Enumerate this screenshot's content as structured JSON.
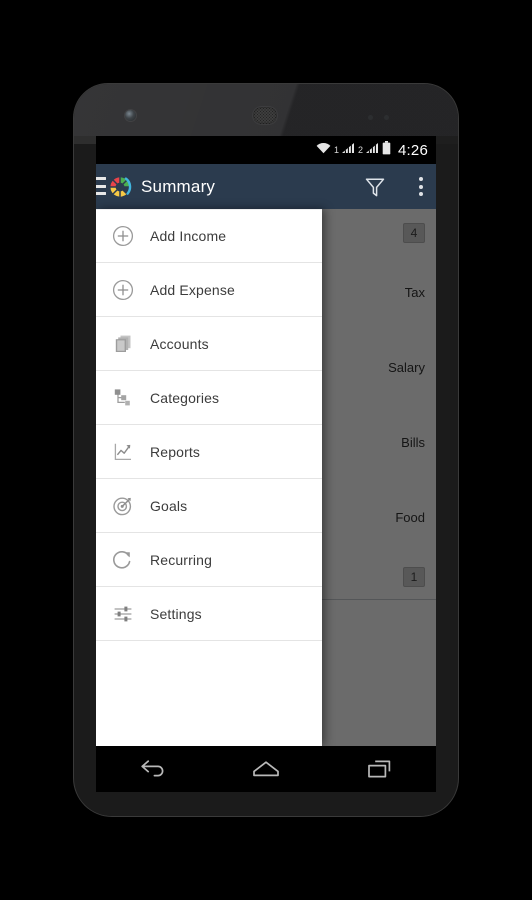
{
  "status_bar": {
    "wifi_icon": "wifi-icon",
    "sim1_label": "1",
    "sim1_signal_icon": "signal-bars-icon",
    "sim2_label": "2",
    "sim2_signal_icon": "signal-bars-icon",
    "battery_icon": "battery-full-icon",
    "clock": "4:26"
  },
  "action_bar": {
    "drawer_toggle_icon": "hamburger-menu-icon",
    "logo_icon": "donut-chart-logo-icon",
    "title": "Summary",
    "filter_icon": "filter-funnel-icon",
    "overflow_icon": "overflow-menu-icon",
    "background_color": "#2b3b4e"
  },
  "drawer": {
    "items": [
      {
        "label": "Add Income",
        "icon": "plus-circle-icon"
      },
      {
        "label": "Add Expense",
        "icon": "plus-circle-icon"
      },
      {
        "label": "Accounts",
        "icon": "stacked-cards-icon"
      },
      {
        "label": "Categories",
        "icon": "hierarchy-nodes-icon"
      },
      {
        "label": "Reports",
        "icon": "line-chart-icon"
      },
      {
        "label": "Goals",
        "icon": "target-dart-icon"
      },
      {
        "label": "Recurring",
        "icon": "refresh-circular-arrow-icon"
      },
      {
        "label": "Settings",
        "icon": "sliders-tune-icon"
      }
    ]
  },
  "content": {
    "badge_top": "4",
    "badge_bottom": "1",
    "rows": [
      "Tax",
      "Salary",
      "Bills",
      "Food"
    ]
  },
  "nav_bar": {
    "back_icon": "back-arrow-icon",
    "home_icon": "home-pentagon-icon",
    "recents_icon": "recent-apps-icon"
  },
  "theme": {
    "accent": "#2b3b4e",
    "logo_red": "#e8444a",
    "logo_green": "#4caf50",
    "logo_yellow": "#f6c945",
    "logo_blue": "#41b6e0",
    "drawer_bg": "#ffffff",
    "scrim": "rgba(0,0,0,0.58)"
  }
}
